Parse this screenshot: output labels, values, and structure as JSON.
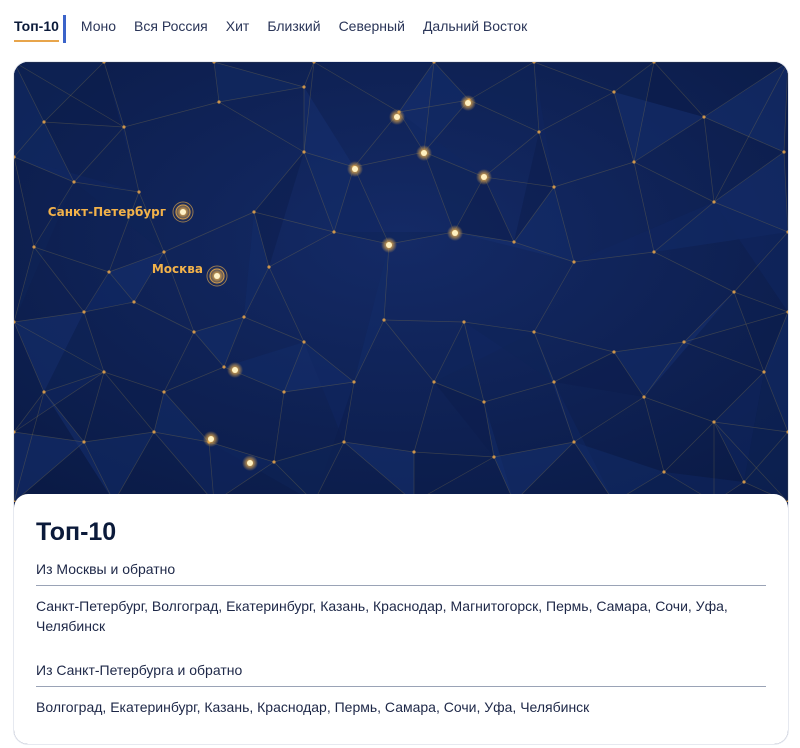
{
  "tabs": [
    {
      "label": "Топ-10",
      "active": true
    },
    {
      "label": "Моно",
      "active": false
    },
    {
      "label": "Вся Россия",
      "active": false
    },
    {
      "label": "Хит",
      "active": false
    },
    {
      "label": "Близкий",
      "active": false
    },
    {
      "label": "Северный",
      "active": false
    },
    {
      "label": "Дальний Восток",
      "active": false
    }
  ],
  "map": {
    "labels": {
      "spb": "Санкт-Петербург",
      "moscow": "Москва"
    },
    "colors": {
      "background": "#0e1f4d",
      "dot": "#f2b24a",
      "line": "#6b6a4a"
    }
  },
  "info": {
    "title": "Топ-10",
    "section1": {
      "title": "Из Москвы и обратно",
      "cities": "Санкт-Петербург, Волгоград, Екатеринбург, Казань, Краснодар, Магнитогорск, Пермь, Самара, Сочи, Уфа, Челябинск"
    },
    "section2": {
      "title": "Из Санкт-Петербурга и обратно",
      "cities": "Волгоград, Екатеринбург, Казань, Краснодар, Пермь, Самара, Сочи, Уфа, Челябинск"
    }
  }
}
